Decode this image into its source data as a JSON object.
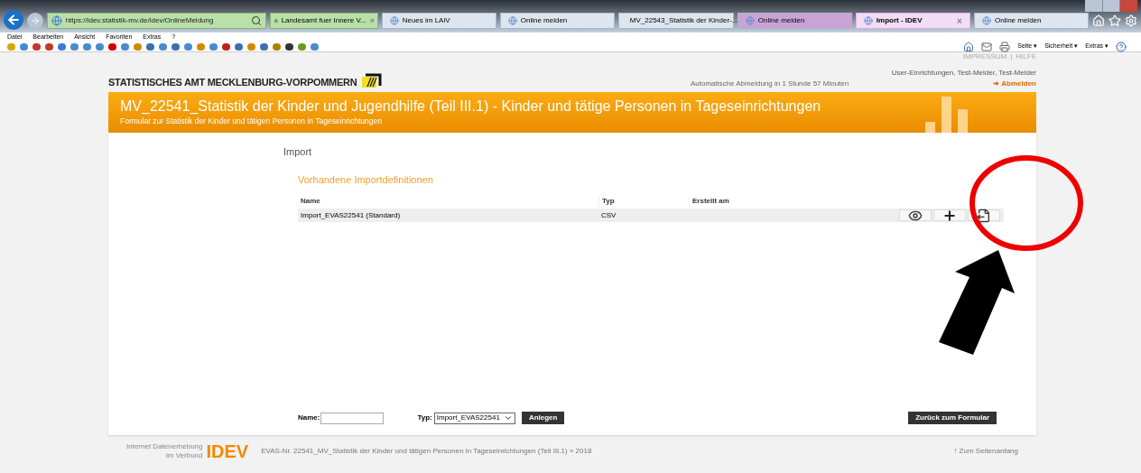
{
  "browser": {
    "address": "https://idev.statistik-mv.de/idev/OnlineMeldung",
    "site_identity": "Landesamt fuer Innere V...",
    "tabs": [
      {
        "label": "Neues im LAiV",
        "selected": false,
        "color": "#dde6ef"
      },
      {
        "label": "Online melden",
        "selected": false,
        "color": "#dde6ef"
      },
      {
        "label": "MV_22543_Statistik der Kinder-...",
        "selected": false,
        "color": "#dde6ef"
      },
      {
        "label": "Online melden",
        "selected": false,
        "color": "#c9a3d6"
      },
      {
        "label": "Import - IDEV",
        "selected": true,
        "color": "#f3dcf5",
        "close": "×"
      },
      {
        "label": "Online melden",
        "selected": false,
        "color": "#dde6ef"
      }
    ],
    "menu": [
      "Datei",
      "Bearbeiten",
      "Ansicht",
      "Favoriten",
      "Extras",
      "?"
    ],
    "command_bar": [
      "Seite ▾",
      "Sicherheit ▾",
      "Extras ▾"
    ]
  },
  "header": {
    "logo": "STATISTISCHES AMT MECKLENBURG-VORPOMMERN",
    "links": [
      "IMPRESSUM",
      "HILFE"
    ],
    "separator": "|",
    "session": "Automatische Abmeldung in 1 Stunde 57 Minuten",
    "user": "User-Einrichtungen, Test-Melder, Test-Melder",
    "logout": "➜ Abmelden"
  },
  "banner": {
    "title": "MV_22541_Statistik der Kinder und Jugendhilfe (Teil III.1) - Kinder und tätige Personen in Tageseinrichtungen",
    "subtitle": "Formular zur Statistik der Kinder und tätigen Personen in Tageseinrichtungen"
  },
  "page": {
    "heading": "Import",
    "section": "Vorhandene Importdefinitionen",
    "table": {
      "columns": [
        "Name",
        "Typ",
        "Erstellt am"
      ],
      "rows": [
        {
          "cells": [
            "Import_EVAS22541 (Standard)",
            "CSV",
            ""
          ],
          "actions": [
            {
              "kind": "view"
            },
            {
              "kind": "add"
            },
            {
              "kind": "export"
            }
          ]
        }
      ]
    },
    "form": {
      "name_label": "Name:",
      "type_label": "Typ:",
      "type_value": "Import_EVAS22541",
      "create": "Anlegen",
      "back": "Zurück zum Formular"
    }
  },
  "footer": {
    "logo_small_1": "Internet Datenerhebung",
    "logo_small_2": "im Verbund",
    "logo": "IDEV",
    "text": "EVAS-Nr. 22541_MV_Statistik der Kinder und tätigen Personen in Tageseinrichtungen (Teil III.1) » 2018",
    "top_link": "↑ Zum Seitenanfang"
  }
}
